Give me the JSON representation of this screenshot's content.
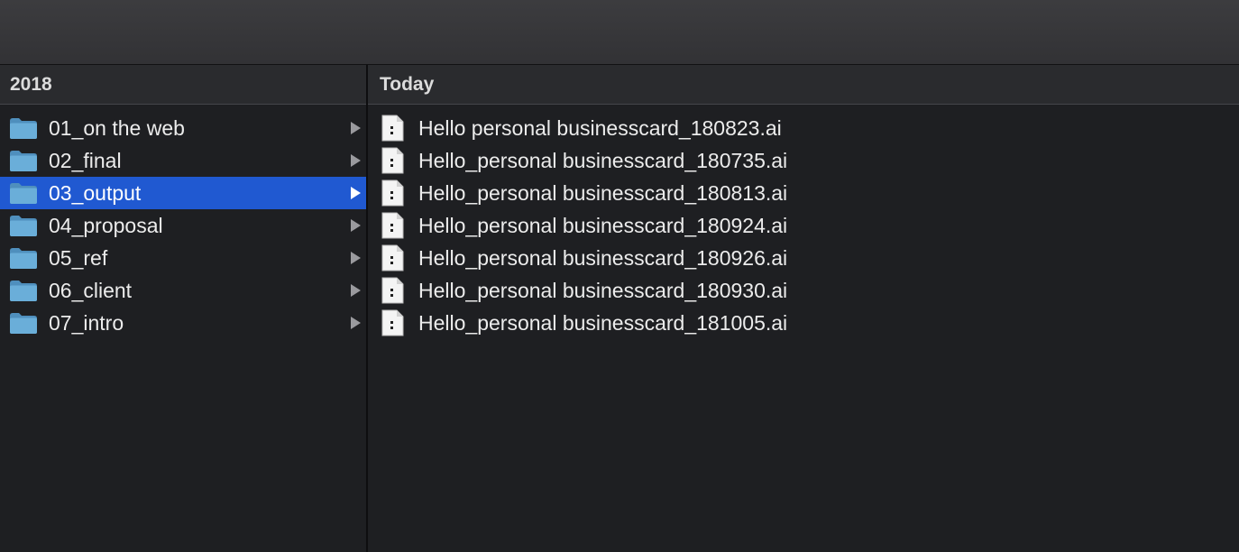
{
  "left_column": {
    "header": "2018",
    "items": [
      {
        "label": "01_on the web",
        "selected": false
      },
      {
        "label": "02_final",
        "selected": false
      },
      {
        "label": "03_output",
        "selected": true
      },
      {
        "label": "04_proposal",
        "selected": false
      },
      {
        "label": "05_ref",
        "selected": false
      },
      {
        "label": "06_client",
        "selected": false
      },
      {
        "label": "07_intro",
        "selected": false
      }
    ],
    "icon": "folder-icon",
    "folder_color": "#6aaed9",
    "selection_color": "#2059d1"
  },
  "right_column": {
    "header": "Today",
    "files": [
      {
        "label": "Hello personal businesscard_180823.ai"
      },
      {
        "label": "Hello_personal businesscard_180735.ai"
      },
      {
        "label": "Hello_personal businesscard_180813.ai"
      },
      {
        "label": "Hello_personal businesscard_180924.ai"
      },
      {
        "label": "Hello_personal businesscard_180926.ai"
      },
      {
        "label": "Hello_personal businesscard_180930.ai"
      },
      {
        "label": "Hello_personal businesscard_181005.ai"
      }
    ],
    "icon": "document-icon"
  }
}
